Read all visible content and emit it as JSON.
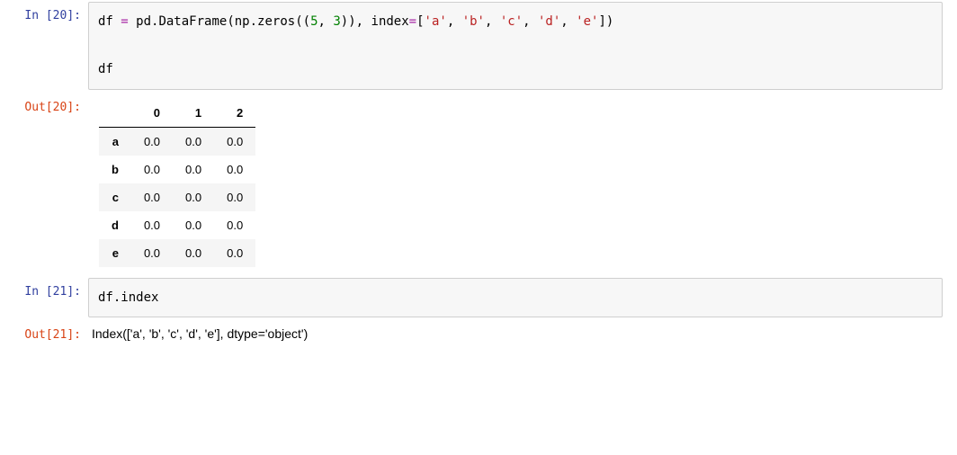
{
  "cells": {
    "c0": {
      "in_prompt": "In [20]:",
      "out_prompt": "Out[20]:",
      "code_tokens": {
        "t0": "df",
        "t1": " = ",
        "t2": "pd",
        "t3": ".",
        "t4": "DataFrame",
        "t5": "(",
        "t6": "np",
        "t7": ".",
        "t8": "zeros",
        "t9": "((",
        "t10": "5",
        "t11": ", ",
        "t12": "3",
        "t13": ")), index",
        "t14": "=",
        "t15": "[",
        "t16": "'a'",
        "t17": ", ",
        "t18": "'b'",
        "t19": ", ",
        "t20": "'c'",
        "t21": ", ",
        "t22": "'d'",
        "t23": ", ",
        "t24": "'e'",
        "t25": "])",
        "line2": "df"
      },
      "df": {
        "columns": [
          "0",
          "1",
          "2"
        ],
        "index": [
          "a",
          "b",
          "c",
          "d",
          "e"
        ],
        "data": [
          [
            "0.0",
            "0.0",
            "0.0"
          ],
          [
            "0.0",
            "0.0",
            "0.0"
          ],
          [
            "0.0",
            "0.0",
            "0.0"
          ],
          [
            "0.0",
            "0.0",
            "0.0"
          ],
          [
            "0.0",
            "0.0",
            "0.0"
          ]
        ]
      }
    },
    "c1": {
      "in_prompt": "In [21]:",
      "out_prompt": "Out[21]:",
      "code_tokens": {
        "t0": "df",
        "t1": ".",
        "t2": "index"
      },
      "out_text": "Index(['a', 'b', 'c', 'd', 'e'], dtype='object')"
    }
  }
}
